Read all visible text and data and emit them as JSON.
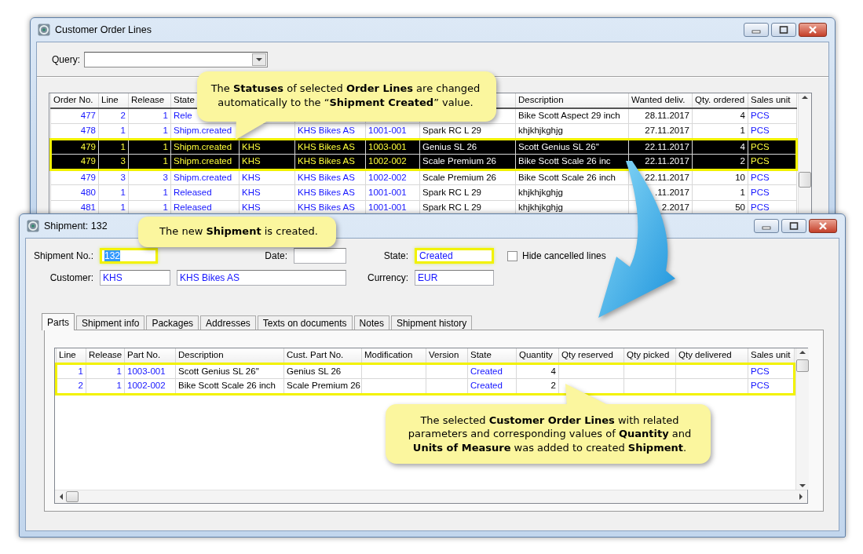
{
  "order_lines_window": {
    "title": "Customer Order Lines",
    "query": {
      "label": "Query:"
    },
    "table": {
      "columns": [
        "Order No.",
        "Line",
        "Release",
        "State",
        null,
        null,
        null,
        null,
        "Description",
        "Wanted deliv.",
        "Qty. ordered",
        "Sales unit"
      ],
      "rows": [
        {
          "selected": false,
          "cells": [
            "477",
            "2",
            "1",
            "Rele",
            null,
            null,
            null,
            null,
            "Bike Scott Aspect 29 inch",
            "28.11.2017",
            "4",
            "PCS"
          ]
        },
        {
          "selected": false,
          "cells": [
            "478",
            "1",
            "1",
            "Shipm.created",
            null,
            "KHS Bikes AS",
            "1001-001",
            "Spark RC L 29",
            "khjkhjkghjg",
            "27.11.2017",
            "1",
            "PCS"
          ]
        },
        {
          "selected": true,
          "cells": [
            "479",
            "1",
            "1",
            "Shipm.created",
            "KHS",
            "KHS Bikes AS",
            "1003-001",
            "Genius SL 26",
            "Scott Genius SL 26''",
            "22.11.2017",
            "4",
            "PCS"
          ]
        },
        {
          "selected": true,
          "cells": [
            "479",
            "3",
            "1",
            "Shipm.created",
            "KHS",
            "KHS Bikes AS",
            "1002-002",
            "Scale Premium 26",
            "Bike Scott Scale 26 inc",
            "22.11.2017",
            "2",
            "PCS"
          ]
        },
        {
          "selected": false,
          "cells": [
            "479",
            "3",
            "3",
            "Shipm.created",
            "KHS",
            "KHS Bikes AS",
            "1002-002",
            "Scale Premium 26",
            "Bike Scott Scale 26 inch",
            "22.11.2017",
            "10",
            "PCS"
          ]
        },
        {
          "selected": false,
          "cells": [
            "480",
            "1",
            "1",
            "Released",
            "KHS",
            "KHS Bikes AS",
            "1001-001",
            "Spark RC L 29",
            "khjkhjkghjg",
            ".11.2017",
            "1",
            "PCS"
          ]
        },
        {
          "selected": false,
          "cells": [
            "481",
            "1",
            "1",
            "Released",
            "KHS",
            "KHS Bikes AS",
            "1001-001",
            "Spark RC L 29",
            "khjkhjkghjg",
            "2.2017",
            "50",
            "PCS"
          ]
        }
      ]
    }
  },
  "shipment_window": {
    "title": "Shipment: 132",
    "header": {
      "shipment_no": {
        "label": "Shipment No.:",
        "value": "132",
        "text_selected": true,
        "highlighted": true
      },
      "date": {
        "label": "Date:"
      },
      "state": {
        "label": "State:",
        "value": "Created",
        "highlighted": true
      },
      "hide_cancelled": {
        "label": "Hide cancelled lines",
        "checked": false
      },
      "customer": {
        "label": "Customer:",
        "id": "KHS",
        "name": "KHS Bikes AS"
      },
      "currency": {
        "label": "Currency:",
        "value": "EUR"
      }
    },
    "tabs": [
      {
        "label": "Parts",
        "selected": true
      },
      {
        "label": "Shipment info",
        "selected": false
      },
      {
        "label": "Packages",
        "selected": false
      },
      {
        "label": "Addresses",
        "selected": false
      },
      {
        "label": "Texts on documents",
        "selected": false
      },
      {
        "label": "Notes",
        "selected": false
      },
      {
        "label": "Shipment history",
        "selected": false
      }
    ],
    "table": {
      "columns": [
        "Line",
        "Release",
        "Part No.",
        "Description",
        "Cust. Part No.",
        "Modification",
        "Version",
        "State",
        "Quantity",
        "Qty reserved",
        "Qty picked",
        "Qty delivered",
        "Sales unit"
      ],
      "rows": [
        {
          "highlighted": true,
          "cells": [
            "1",
            "1",
            "1003-001",
            "Scott Genius SL 26''",
            "Genius SL 26",
            null,
            null,
            "Created",
            "4",
            null,
            null,
            null,
            "PCS"
          ]
        },
        {
          "highlighted": true,
          "cells": [
            "2",
            "1",
            "1002-002",
            "Bike Scott Scale 26 inch",
            "Scale Premium 26",
            null,
            null,
            "Created",
            "2",
            null,
            null,
            null,
            "PCS"
          ]
        }
      ]
    }
  },
  "callouts": [
    {
      "kind": "tail_down",
      "text": "The **Statuses** of selected **Order Lines** are changed automatically to the “**Shipment Created**” value."
    },
    {
      "kind": "plain",
      "text": "The new **Shipment** is created."
    },
    {
      "kind": "tail_up",
      "text": "The selected **Customer Order Lines** with related parameters and corresponding values of **Quantity** and **Units of Measure** was added to created **Shipment**."
    }
  ]
}
